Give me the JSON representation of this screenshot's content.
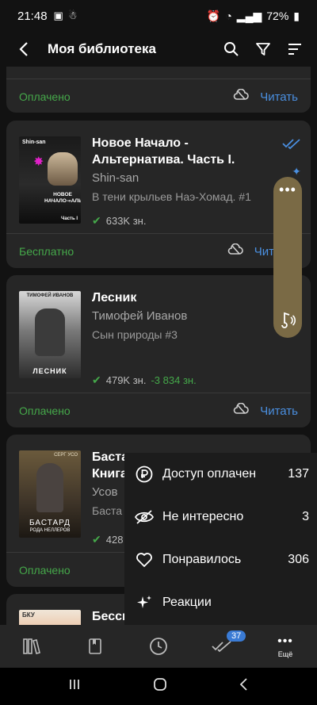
{
  "status_bar": {
    "time": "21:48",
    "battery": "72%"
  },
  "app_bar": {
    "title": "Моя библиотека"
  },
  "cards": [
    {
      "status": "Оплачено",
      "read_label": "Читать"
    },
    {
      "title": "Новое Начало - Альтернатива. Часть I.",
      "author": "Shin-san",
      "series": "В тени крыльев Наэ-Хомад. #1",
      "size": "633K зн.",
      "status": "Бесплатно",
      "read_label": "Чит",
      "cover_text": {
        "top": "Shin-san",
        "main": "НОВОЕ НАЧАЛО-«АЛЬТЕРНАТИВА»",
        "part": "Часть I"
      }
    },
    {
      "title": "Лесник",
      "author": "Тимофей Иванов",
      "series": "Сын природы #3",
      "size": "479K зн.",
      "delta": "-3 834 зн.",
      "status": "Оплачено",
      "read_label": "Читать",
      "cover_text": {
        "top": "ТИМОФЕЙ ИВАНОВ",
        "bottom": "ЛЕСНИК"
      }
    },
    {
      "title": "Бастард",
      "title_line2": "Книга",
      "author": "Усов",
      "series": "Баста",
      "size": "428",
      "status": "Оплачено",
      "cover_text": {
        "top": "СЕРГ УСО",
        "main": "БАСТАРД",
        "sub": "РОДА НЕЛЛЕРОВ"
      }
    },
    {
      "title": "Бессм",
      "cover_text": {
        "top": "БКУ"
      }
    }
  ],
  "menu": [
    {
      "icon": "ruble-icon",
      "label": "Доступ оплачен",
      "count": "137"
    },
    {
      "icon": "eye-off-icon",
      "label": "Не интересно",
      "count": "3"
    },
    {
      "icon": "heart-icon",
      "label": "Понравилось",
      "count": "306"
    },
    {
      "icon": "sparkles-icon",
      "label": "Реакции",
      "count": ""
    }
  ],
  "bottom_nav": {
    "badge": "37",
    "more_label": "Ещё"
  },
  "colors": {
    "accent": "#4a8fe0",
    "success": "#45a84a",
    "card": "#262626",
    "floating": "#7a6a45"
  }
}
